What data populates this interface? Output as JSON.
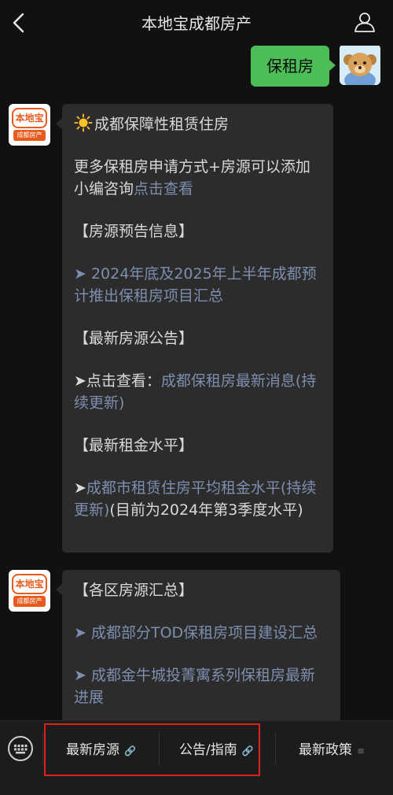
{
  "header": {
    "title": "本地宝成都房产"
  },
  "user_message": {
    "text": "保租房"
  },
  "bot_logo": {
    "top_text": "本地宝",
    "bottom_text": "成都房产"
  },
  "message1": {
    "title": "成都保障性租赁住房",
    "intro_text": "更多保租房申请方式+房源可以添加小编咨询",
    "intro_link": "点击查看",
    "section1_heading": "【房源预告信息】",
    "section1_arrow": "➤ ",
    "section1_link": "2024年底及2025年上半年成都预计推出保租房项目汇总",
    "section2_heading": "【最新房源公告】",
    "section2_prefix": "➤点击查看：",
    "section2_link": "成都保租房最新消息(持续更新)",
    "section3_heading": "【最新租金水平】",
    "section3_arrow": "➤",
    "section3_link": "成都市租赁住房平均租金水平(持续更新)",
    "section3_suffix": "(目前为2024年第3季度水平)"
  },
  "message2": {
    "heading": "【各区房源汇总】",
    "item1_arrow": "➤ ",
    "item1_link": "成都部分TOD保租房项目建设汇总",
    "item2_arrow": "➤ ",
    "item2_link": "成都金牛城投菁寓系列保租房最新进展"
  },
  "bottom_menu": {
    "items": [
      {
        "label": "最新房源",
        "icon": "link-icon"
      },
      {
        "label": "公告/指南",
        "icon": "link-icon"
      },
      {
        "label": "最新政策",
        "icon": "menu-icon"
      }
    ]
  },
  "colors": {
    "user_bubble": "#4dbd58",
    "bot_bubble": "#2c2c2c",
    "link": "#7d8eae",
    "highlight": "#e0201b",
    "brand": "#e85b1c"
  }
}
